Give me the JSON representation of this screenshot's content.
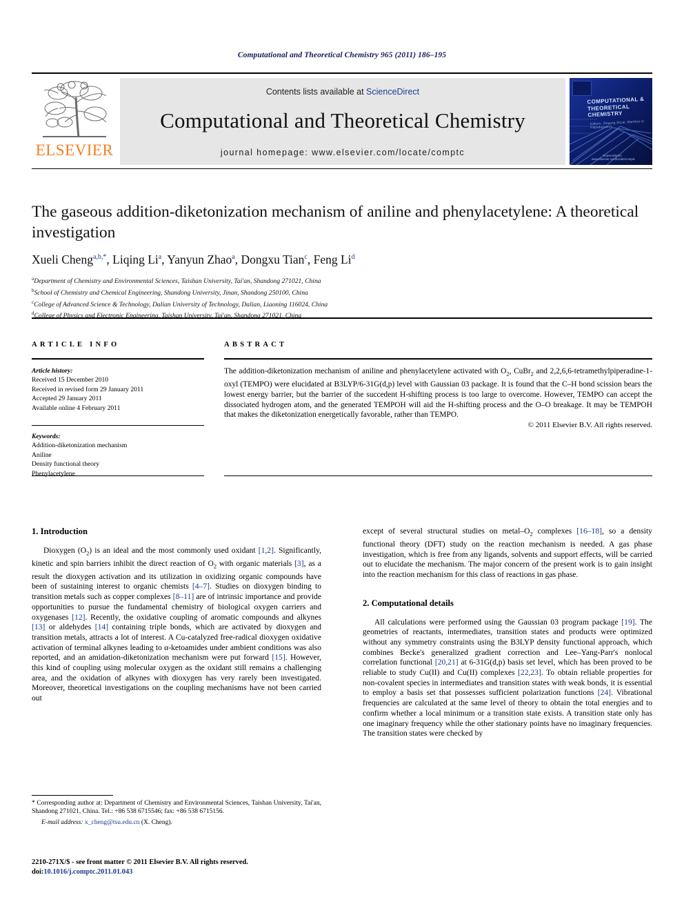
{
  "running_head": "Computational and Theoretical Chemistry 965 (2011) 186–195",
  "masthead": {
    "contents_prefix": "Contents lists available at ",
    "sciencedirect": "ScienceDirect",
    "journal_name": "Computational and Theoretical Chemistry",
    "homepage": "journal homepage: www.elsevier.com/locate/comptc",
    "publisher_wordmark": "ELSEVIER",
    "cover_title": "COMPUTATIONAL & THEORETICAL CHEMISTRY",
    "cover_subtitle": "Editors: Zhigang Shuai, Manthos G. Papadopoulos",
    "cover_footer": "ScienceDirect  www.elsevier.com/locate/comptc"
  },
  "article": {
    "title": "The gaseous addition-diketonization mechanism of aniline and phenylacetylene: A theoretical investigation",
    "authors_html": "Xueli Cheng<sup>a,b,*</sup>, Liqing Li<sup>a</sup>, Yanyun Zhao<sup>a</sup>, Dongxu Tian<sup>c</sup>, Feng Li<sup>d</sup>",
    "affiliations": [
      "a Department of Chemistry and Environmental Sciences, Taishan University, Tai'an, Shandong 271021, China",
      "b School of Chemistry and Chemical Engineering, Shandong University, Jinan, Shandong 250100, China",
      "c College of Advanced Science & Technology, Dalian University of Technology, Dalian, Liaoning 116024, China",
      "d College of Physics and Electronic Engineering, Taishan University, Tai'an, Shandong 271021, China"
    ]
  },
  "article_info": {
    "label": "ARTICLE INFO",
    "history_label": "Article history:",
    "history": [
      "Received 15 December 2010",
      "Received in revised form 29 January 2011",
      "Accepted 29 January 2011",
      "Available online 4 February 2011"
    ],
    "keywords_label": "Keywords:",
    "keywords": [
      "Addition-diketonization mechanism",
      "Aniline",
      "Density functional theory",
      "Phenylacetylene"
    ]
  },
  "abstract": {
    "label": "ABSTRACT",
    "text": "The addition-diketonization mechanism of aniline and phenylacetylene activated with O2, CuBr2 and 2,2,6,6-tetramethylpiperadine-1-oxyl (TEMPO) were elucidated at B3LYP/6-31G(d,p) level with Gaussian 03 package. It is found that the C–H bond scission bears the lowest energy barrier, but the barrier of the succedent H-shifting process is too large to overcome. However, TEMPO can accept the dissociated hydrogen atom, and the generated TEMPOH will aid the H-shifting process and the O–O breakage. It may be TEMPOH that makes the diketonization energetically favorable, rather than TEMPO.",
    "copyright": "© 2011 Elsevier B.V. All rights reserved."
  },
  "sections": {
    "intro_heading": "1. Introduction",
    "intro_paragraph": "Dioxygen (O2) is an ideal and the most commonly used oxidant [1,2]. Significantly, kinetic and spin barriers inhibit the direct reaction of O2 with organic materials [3], as a result the dioxygen activation and its utilization in oxidizing organic compounds have been of sustaining interest to organic chemists [4–7]. Studies on dioxygen binding to transition metals such as copper complexes [8–11] are of intrinsic importance and provide opportunities to pursue the fundamental chemistry of biological oxygen carriers and oxygenases [12]. Recently, the oxidative coupling of aromatic compounds and alkynes [13] or aldehydes [14] containing triple bonds, which are activated by dioxygen and transition metals, attracts a lot of interest. A Cu-catalyzed free-radical dioxygen oxidative activation of terminal alkynes leading to α-ketoamides under ambient conditions was also reported, and an amidation-diketonization mechanism were put forward [15]. However, this kind of coupling using molecular oxygen as the oxidant still remains a challenging area, and the oxidation of alkynes with dioxygen has very rarely been investigated. Moreover, theoretical investigations on the coupling mechanisms have not been carried out except of several structural studies on metal–O2 complexes [16–18], so a density functional theory (DFT) study on the reaction mechanism is needed. A gas phase investigation, which is free from any ligands, solvents and support effects, will be carried out to elucidate the mechanism. The major concern of the present work is to gain insight into the reaction mechanism for this class of reactions in gas phase.",
    "comp_heading": "2. Computational details",
    "comp_paragraph": "All calculations were performed using the Gaussian 03 program package [19]. The geometries of reactants, intermediates, transition states and products were optimized without any symmetry constraints using the B3LYP density functional approach, which combines Becke's generalized gradient correction and Lee–Yang-Parr's nonlocal correlation functional [20,21] at 6-31G(d,p) basis set level, which has been proved to be reliable to study Cu(II) and Cu(II) complexes [22,23]. To obtain reliable properties for non-covalent species in intermediates and transition states with weak bonds, it is essential to employ a basis set that possesses sufficient polarization functions [24]. Vibrational frequencies are calculated at the same level of theory to obtain the total energies and to confirm whether a local minimum or a transition state exists. A transition state only has one imaginary frequency while the other stationary points have no imaginary frequencies. The transition states were checked by"
  },
  "footnotes": {
    "corresponding": "* Corresponding author at: Department of Chemistry and Environmental Sciences, Taishan University, Tai'an, Shandong 271021, China. Tel.: +86 538 6715546; fax: +86 538 6715156.",
    "email_label": "E-mail address:",
    "email": "x_cheng@tsu.edu.cn",
    "email_owner": "(X. Cheng).",
    "issn_line": "2210-271X/$ - see front matter © 2011 Elsevier B.V. All rights reserved.",
    "doi_label": "doi:",
    "doi": "10.1016/j.comptc.2011.01.043"
  },
  "colors": {
    "link": "#1a3a8f",
    "elsevier_orange": "#f47d20",
    "masthead_bg": "#e6e6e6",
    "runhead": "#1a1a5e"
  }
}
